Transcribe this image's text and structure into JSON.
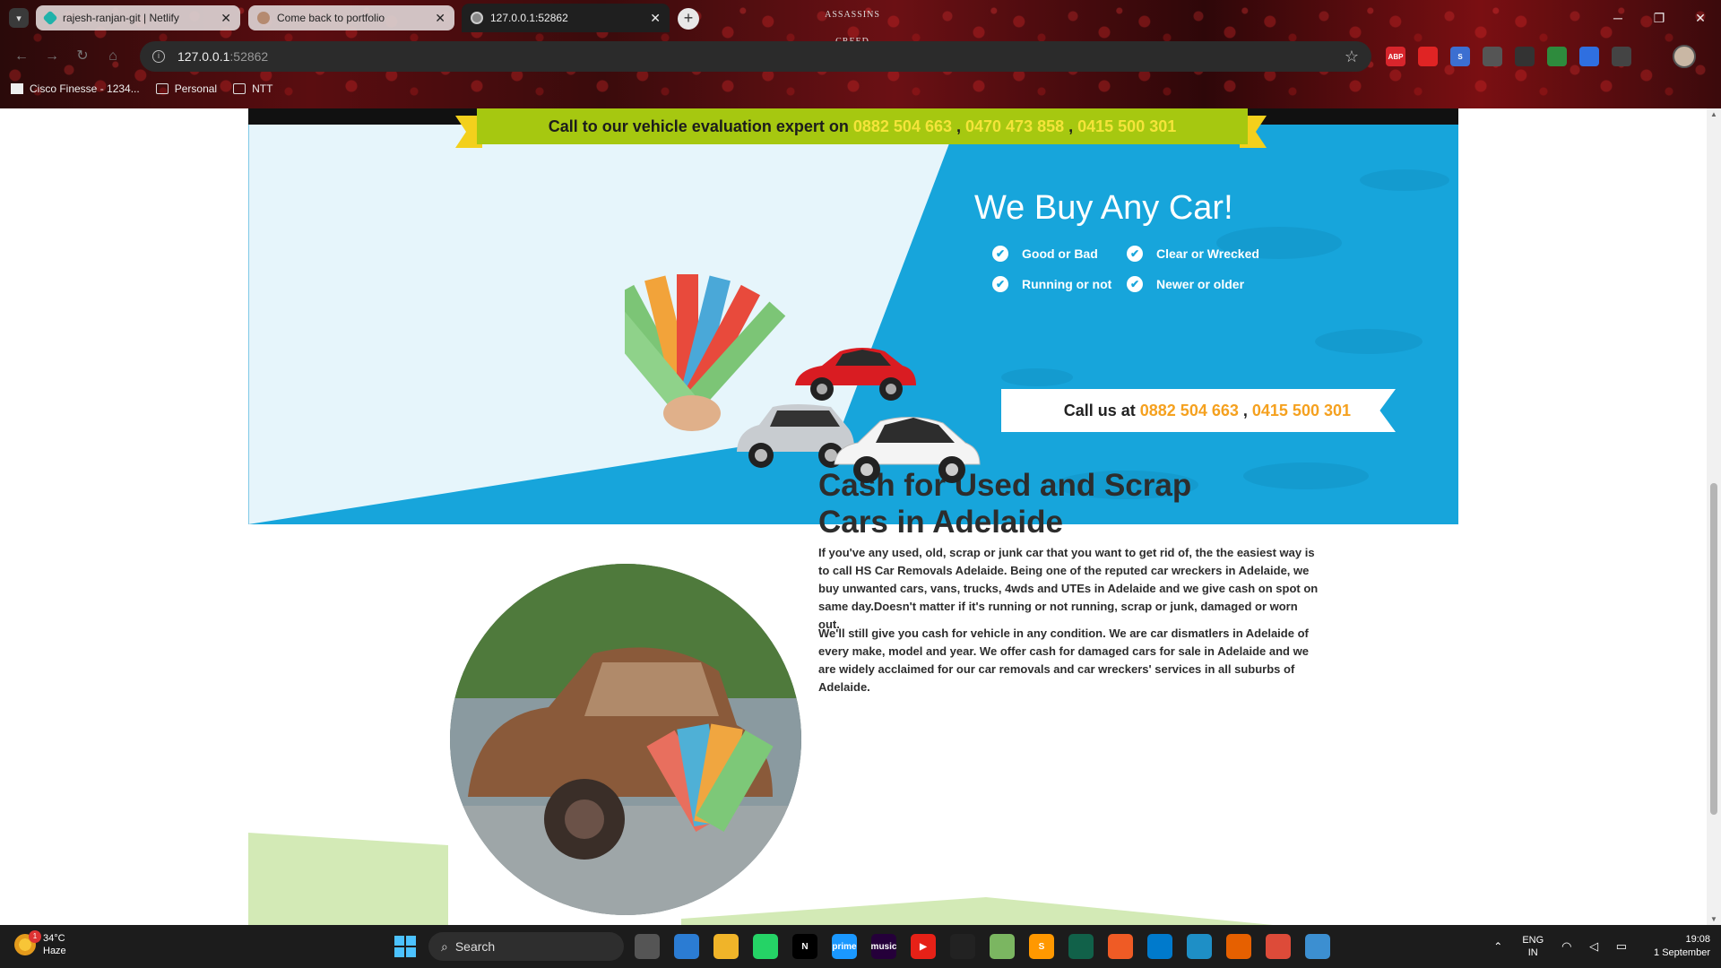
{
  "browser": {
    "tabs": [
      {
        "label": "rajesh-ranjan-git | Netlify",
        "favicon": "netlify-icon",
        "active": false
      },
      {
        "label": "Come back to portfolio",
        "favicon": "avatar-icon",
        "active": false
      },
      {
        "label": "127.0.0.1:52862",
        "favicon": "globe-icon",
        "active": true
      }
    ],
    "address": {
      "host": "127.0.0.1",
      "port": ":52862"
    },
    "bookmarks": [
      {
        "label": "Cisco Finesse - 1234...",
        "icon": "cisco-icon"
      },
      {
        "label": "Personal",
        "icon": "folder-icon"
      },
      {
        "label": "NTT",
        "icon": "folder-icon"
      }
    ],
    "theme_logo": "ASSASSINS CREED",
    "extensions": [
      {
        "name": "abp-icon",
        "text": "ABP",
        "color": "#d8252c"
      },
      {
        "name": "red-extension-icon",
        "text": "",
        "color": "#e02424"
      },
      {
        "name": "s-extension-icon",
        "text": "S",
        "color": "#3c6fd1"
      },
      {
        "name": "target-extension-icon",
        "text": "",
        "color": "#555555"
      },
      {
        "name": "react-devtools-icon",
        "text": "",
        "color": "#333333"
      },
      {
        "name": "green-extension-icon",
        "text": "",
        "color": "#2e8b3d"
      },
      {
        "name": "doc-extension-icon",
        "text": "",
        "color": "#2f6fe0"
      },
      {
        "name": "puzzle-icon",
        "text": "",
        "color": "#444444"
      }
    ]
  },
  "hero": {
    "call_prefix": "Call to our vehicle evaluation expert on",
    "phones": [
      "0882 504 663",
      "0470 473 858",
      "0415 500 301"
    ],
    "separator": " , ",
    "title": "We Buy Any Car!",
    "features": [
      "Good or Bad",
      "Clear or Wrecked",
      "Running or not",
      "Newer or older"
    ],
    "call_us_prefix": "Call us at",
    "call_us_phones": [
      "0882 504 663",
      "0415 500 301"
    ],
    "colors": {
      "ribbon": "#a6c810",
      "ribbon_end": "#f3d01c",
      "sky": "#17a5db",
      "light": "#e6f5fb",
      "orange": "#f5a11f"
    }
  },
  "content": {
    "title": "Cash for Used and Scrap Cars in Adelaide",
    "paragraphs": [
      "If you've any used, old, scrap or junk car that you want to get rid of, the the easiest way is to call HS Car Removals Adelaide. Being one of the reputed car wreckers in Adelaide, we buy unwanted cars, vans, trucks, 4wds and UTEs in Adelaide and we give cash on spot on same day.Doesn't matter if it's running or not running, scrap or junk, damaged or worn out.",
      "We'll still give you cash for vehicle in any condition. We are car dismatlers in Adelaide of every make, model and year. We offer cash for damaged cars for sale in Adelaide and we are widely acclaimed for our car removals and car wreckers' services in all suburbs of Adelaide."
    ]
  },
  "taskbar": {
    "weather": {
      "temp": "34°C",
      "condition": "Haze",
      "badge": "1"
    },
    "search_label": "Search",
    "apps": [
      {
        "name": "task-view-icon",
        "text": "",
        "color": "#555555"
      },
      {
        "name": "store-icon",
        "text": "",
        "color": "#2b7cd3"
      },
      {
        "name": "file-explorer-icon",
        "text": "",
        "color": "#f0b429"
      },
      {
        "name": "whatsapp-icon",
        "text": "",
        "color": "#25d366"
      },
      {
        "name": "netflix-icon",
        "text": "N",
        "color": "#000000"
      },
      {
        "name": "prime-video-icon",
        "text": "prime",
        "color": "#1a98ff"
      },
      {
        "name": "amazon-music-icon",
        "text": "music",
        "color": "#25003a"
      },
      {
        "name": "youtube-icon",
        "text": "▶",
        "color": "#e62117"
      },
      {
        "name": "github-icon",
        "text": "",
        "color": "#222222"
      },
      {
        "name": "notepad-icon",
        "text": "",
        "color": "#7bb661"
      },
      {
        "name": "sublime-icon",
        "text": "S",
        "color": "#ff9800"
      },
      {
        "name": "mongodb-icon",
        "text": "",
        "color": "#116149"
      },
      {
        "name": "postman-icon",
        "text": "",
        "color": "#ef5b25"
      },
      {
        "name": "vscode-icon",
        "text": "",
        "color": "#007acc"
      },
      {
        "name": "edge-icon",
        "text": "",
        "color": "#1e8fc6"
      },
      {
        "name": "firefox-icon",
        "text": "",
        "color": "#e66000"
      },
      {
        "name": "chrome-icon",
        "text": "",
        "color": "#dd4b39"
      },
      {
        "name": "world-icon",
        "text": "",
        "color": "#3c8fd1"
      }
    ],
    "lang": {
      "line1": "ENG",
      "line2": "IN"
    },
    "time": "19:08",
    "date": "1 September"
  }
}
